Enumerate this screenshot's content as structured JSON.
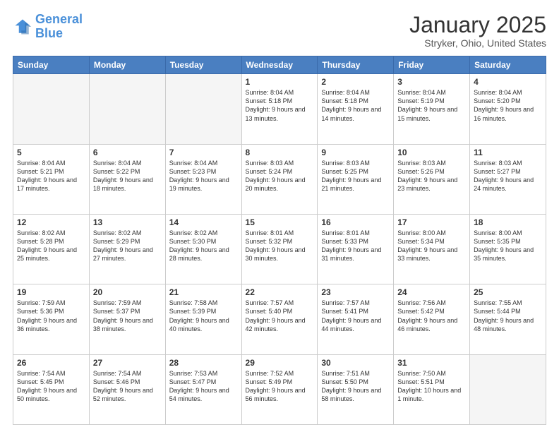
{
  "header": {
    "logo_line1": "General",
    "logo_line2": "Blue",
    "month": "January 2025",
    "location": "Stryker, Ohio, United States"
  },
  "weekdays": [
    "Sunday",
    "Monday",
    "Tuesday",
    "Wednesday",
    "Thursday",
    "Friday",
    "Saturday"
  ],
  "weeks": [
    [
      {
        "day": "",
        "info": ""
      },
      {
        "day": "",
        "info": ""
      },
      {
        "day": "",
        "info": ""
      },
      {
        "day": "1",
        "info": "Sunrise: 8:04 AM\nSunset: 5:18 PM\nDaylight: 9 hours\nand 13 minutes."
      },
      {
        "day": "2",
        "info": "Sunrise: 8:04 AM\nSunset: 5:18 PM\nDaylight: 9 hours\nand 14 minutes."
      },
      {
        "day": "3",
        "info": "Sunrise: 8:04 AM\nSunset: 5:19 PM\nDaylight: 9 hours\nand 15 minutes."
      },
      {
        "day": "4",
        "info": "Sunrise: 8:04 AM\nSunset: 5:20 PM\nDaylight: 9 hours\nand 16 minutes."
      }
    ],
    [
      {
        "day": "5",
        "info": "Sunrise: 8:04 AM\nSunset: 5:21 PM\nDaylight: 9 hours\nand 17 minutes."
      },
      {
        "day": "6",
        "info": "Sunrise: 8:04 AM\nSunset: 5:22 PM\nDaylight: 9 hours\nand 18 minutes."
      },
      {
        "day": "7",
        "info": "Sunrise: 8:04 AM\nSunset: 5:23 PM\nDaylight: 9 hours\nand 19 minutes."
      },
      {
        "day": "8",
        "info": "Sunrise: 8:03 AM\nSunset: 5:24 PM\nDaylight: 9 hours\nand 20 minutes."
      },
      {
        "day": "9",
        "info": "Sunrise: 8:03 AM\nSunset: 5:25 PM\nDaylight: 9 hours\nand 21 minutes."
      },
      {
        "day": "10",
        "info": "Sunrise: 8:03 AM\nSunset: 5:26 PM\nDaylight: 9 hours\nand 23 minutes."
      },
      {
        "day": "11",
        "info": "Sunrise: 8:03 AM\nSunset: 5:27 PM\nDaylight: 9 hours\nand 24 minutes."
      }
    ],
    [
      {
        "day": "12",
        "info": "Sunrise: 8:02 AM\nSunset: 5:28 PM\nDaylight: 9 hours\nand 25 minutes."
      },
      {
        "day": "13",
        "info": "Sunrise: 8:02 AM\nSunset: 5:29 PM\nDaylight: 9 hours\nand 27 minutes."
      },
      {
        "day": "14",
        "info": "Sunrise: 8:02 AM\nSunset: 5:30 PM\nDaylight: 9 hours\nand 28 minutes."
      },
      {
        "day": "15",
        "info": "Sunrise: 8:01 AM\nSunset: 5:32 PM\nDaylight: 9 hours\nand 30 minutes."
      },
      {
        "day": "16",
        "info": "Sunrise: 8:01 AM\nSunset: 5:33 PM\nDaylight: 9 hours\nand 31 minutes."
      },
      {
        "day": "17",
        "info": "Sunrise: 8:00 AM\nSunset: 5:34 PM\nDaylight: 9 hours\nand 33 minutes."
      },
      {
        "day": "18",
        "info": "Sunrise: 8:00 AM\nSunset: 5:35 PM\nDaylight: 9 hours\nand 35 minutes."
      }
    ],
    [
      {
        "day": "19",
        "info": "Sunrise: 7:59 AM\nSunset: 5:36 PM\nDaylight: 9 hours\nand 36 minutes."
      },
      {
        "day": "20",
        "info": "Sunrise: 7:59 AM\nSunset: 5:37 PM\nDaylight: 9 hours\nand 38 minutes."
      },
      {
        "day": "21",
        "info": "Sunrise: 7:58 AM\nSunset: 5:39 PM\nDaylight: 9 hours\nand 40 minutes."
      },
      {
        "day": "22",
        "info": "Sunrise: 7:57 AM\nSunset: 5:40 PM\nDaylight: 9 hours\nand 42 minutes."
      },
      {
        "day": "23",
        "info": "Sunrise: 7:57 AM\nSunset: 5:41 PM\nDaylight: 9 hours\nand 44 minutes."
      },
      {
        "day": "24",
        "info": "Sunrise: 7:56 AM\nSunset: 5:42 PM\nDaylight: 9 hours\nand 46 minutes."
      },
      {
        "day": "25",
        "info": "Sunrise: 7:55 AM\nSunset: 5:44 PM\nDaylight: 9 hours\nand 48 minutes."
      }
    ],
    [
      {
        "day": "26",
        "info": "Sunrise: 7:54 AM\nSunset: 5:45 PM\nDaylight: 9 hours\nand 50 minutes."
      },
      {
        "day": "27",
        "info": "Sunrise: 7:54 AM\nSunset: 5:46 PM\nDaylight: 9 hours\nand 52 minutes."
      },
      {
        "day": "28",
        "info": "Sunrise: 7:53 AM\nSunset: 5:47 PM\nDaylight: 9 hours\nand 54 minutes."
      },
      {
        "day": "29",
        "info": "Sunrise: 7:52 AM\nSunset: 5:49 PM\nDaylight: 9 hours\nand 56 minutes."
      },
      {
        "day": "30",
        "info": "Sunrise: 7:51 AM\nSunset: 5:50 PM\nDaylight: 9 hours\nand 58 minutes."
      },
      {
        "day": "31",
        "info": "Sunrise: 7:50 AM\nSunset: 5:51 PM\nDaylight: 10 hours\nand 1 minute."
      },
      {
        "day": "",
        "info": ""
      }
    ]
  ]
}
